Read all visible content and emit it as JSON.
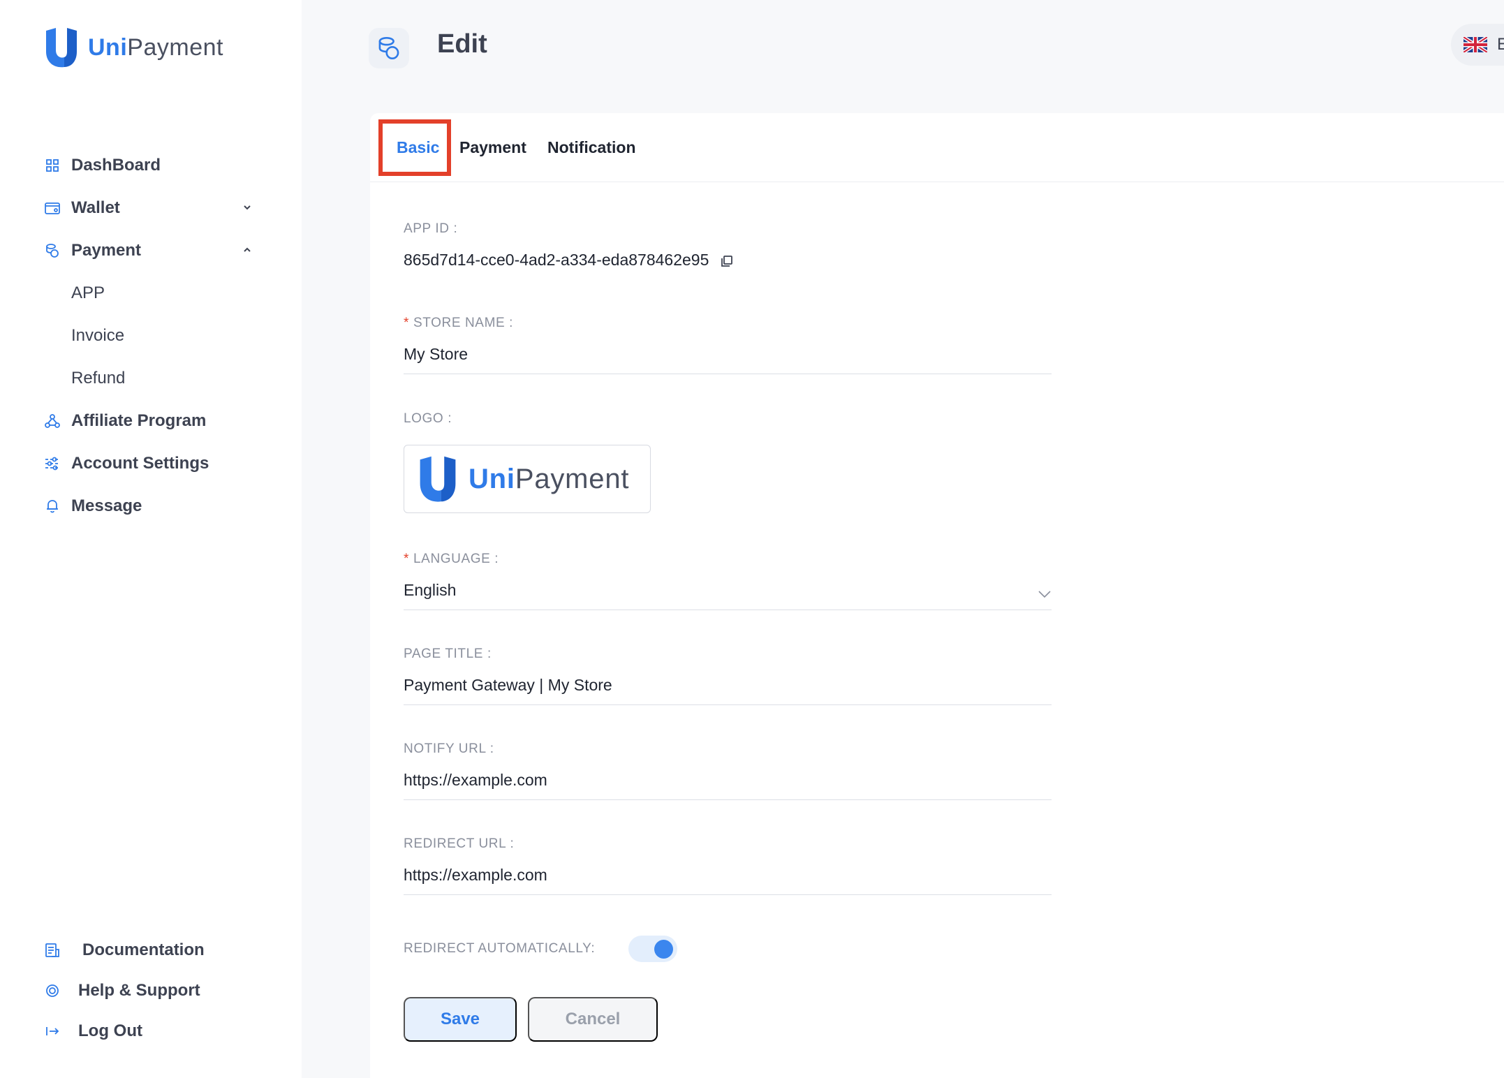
{
  "brand": {
    "name_bold": "Uni",
    "name_rest": "Payment"
  },
  "sidebar": {
    "items": [
      {
        "label": "DashBoard",
        "icon": "dashboard-icon"
      },
      {
        "label": "Wallet",
        "icon": "wallet-icon",
        "chevron": "chevron-down-icon"
      },
      {
        "label": "Payment",
        "icon": "payment-icon",
        "chevron": "chevron-up-icon"
      },
      {
        "label": "APP"
      },
      {
        "label": "Invoice"
      },
      {
        "label": "Refund"
      },
      {
        "label": "Affiliate Program",
        "icon": "affiliate-icon"
      },
      {
        "label": "Account Settings",
        "icon": "settings-sliders-icon"
      },
      {
        "label": "Message",
        "icon": "bell-icon"
      }
    ],
    "bottom": [
      {
        "label": "Documentation",
        "icon": "document-icon"
      },
      {
        "label": "Help & Support",
        "icon": "lifebuoy-icon"
      },
      {
        "label": "Log Out",
        "icon": "logout-icon"
      }
    ]
  },
  "header": {
    "title": "Edit",
    "icon": "coins-icon",
    "language_code": "E",
    "flag": "uk-flag-icon"
  },
  "tabs": [
    {
      "label": "Basic",
      "active": true
    },
    {
      "label": "Payment",
      "active": false
    },
    {
      "label": "Notification",
      "active": false
    }
  ],
  "form": {
    "app_id": {
      "label": "APP ID",
      "value": "865d7d14-cce0-4ad2-a334-eda878462e95"
    },
    "store_name": {
      "label": "STORE NAME",
      "value": "My Store",
      "required": true
    },
    "logo": {
      "label": "LOGO",
      "text_bold": "Uni",
      "text_rest": "Payment"
    },
    "language": {
      "label": "LANGUAGE",
      "value": "English",
      "required": true
    },
    "page_title": {
      "label": "PAGE TITLE",
      "value": "Payment Gateway | My Store"
    },
    "notify_url": {
      "label": "NOTIFY URL",
      "value": "https://example.com"
    },
    "redirect_url": {
      "label": "REDIRECT URL",
      "value": "https://example.com"
    },
    "redirect_auto": {
      "label": "REDIRECT AUTOMATICALLY:",
      "on": true
    },
    "colon": ":",
    "required_mark": "*"
  },
  "buttons": {
    "save": "Save",
    "cancel": "Cancel"
  },
  "colors": {
    "accent": "#2f7be8",
    "highlight": "#e3402a"
  }
}
